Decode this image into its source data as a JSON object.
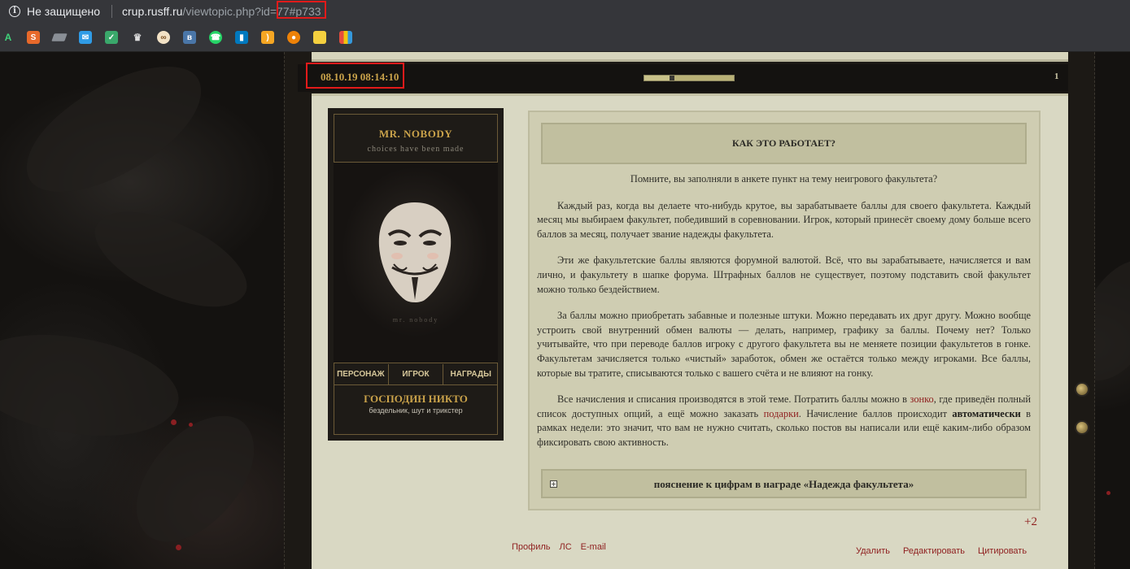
{
  "browser": {
    "security_label": "Не защищено",
    "url_host": "crup.rusff.ru",
    "url_path": "/viewtopic.php?id=77#p733",
    "bookmarks": [
      "bookmark-1",
      "bookmark-2",
      "bookmark-3",
      "bookmark-4",
      "bookmark-5",
      "bookmark-6",
      "bookmark-7",
      "bookmark-8",
      "bookmark-9",
      "bookmark-10",
      "bookmark-11",
      "bookmark-12",
      "bookmark-13",
      "bookmark-14"
    ]
  },
  "post": {
    "date": "08.10.19 08:14:10",
    "number": "1",
    "progress_fraction": 0.28
  },
  "profile": {
    "name": "MR. NOBODY",
    "tagline": "choices have been made",
    "image_caption": "mr. nobody",
    "tabs": [
      "ПЕРСОНАЖ",
      "ИГРОК",
      "НАГРАДЫ"
    ],
    "title": "ГОСПОДИН НИКТО",
    "description": "бездельник, шут и трикстер"
  },
  "content": {
    "heading": "КАК ЭТО РАБОТАЕТ?",
    "lead": "Помните, вы заполняли в анкете пункт на тему неигрового факультета?",
    "p1": "Каждый раз, когда вы делаете что-нибудь крутое, вы зарабатываете баллы для своего факультета. Каждый месяц мы выбираем факультет, победивший в соревновании. Игрок, который принесёт своему дому больше всего баллов за месяц, получает звание надежды факультета.",
    "p2": "Эти же факультетские баллы являются форумной валютой. Всё, что вы зарабатываете, начисляется и вам лично, и факультету в шапке форума. Штрафных баллов не существует, поэтому подставить свой факультет можно только бездействием.",
    "p3": "За баллы можно приобретать забавные и полезные штуки. Можно передавать их друг другу. Можно вообще устроить свой внутренний обмен валюты — делать, например, графику за баллы. Почему нет? Только учитывайте, что при переводе баллов игроку с другого факультета вы не меняете позиции факультетов в гонке. Факультетам зачисляется только «чистый» заработок, обмен же остаётся только между игроками. Все баллы, которые вы тратите, списываются только с вашего счёта и не влияют на гонку.",
    "p4_a": "Все начисления и списания производятся в этой теме. Потратить баллы можно в ",
    "p4_link1": "зонко",
    "p4_b": ", где приведён полный список доступных опций, а ещё можно заказать ",
    "p4_link2": "подарки",
    "p4_c": ". Начисление баллов происходит ",
    "p4_bold": "автоматически",
    "p4_d": " в рамках недели: это значит, что вам не нужно считать, сколько постов вы написали или ещё каким-либо образом фиксировать свою активность.",
    "spoiler_icon": "+",
    "spoiler_label": "пояснение к цифрам в награде «Надежда факультета»"
  },
  "footer": {
    "rating": "+2",
    "left_links": [
      "Профиль",
      "ЛС",
      "E-mail"
    ],
    "right_links": [
      "Удалить",
      "Редактировать",
      "Цитировать"
    ]
  },
  "colors": {
    "accent_gold": "#c9a24a",
    "link_red": "#8f1f1f",
    "highlight_red": "#e21a1a",
    "post_bg": "#d9d8c3"
  }
}
